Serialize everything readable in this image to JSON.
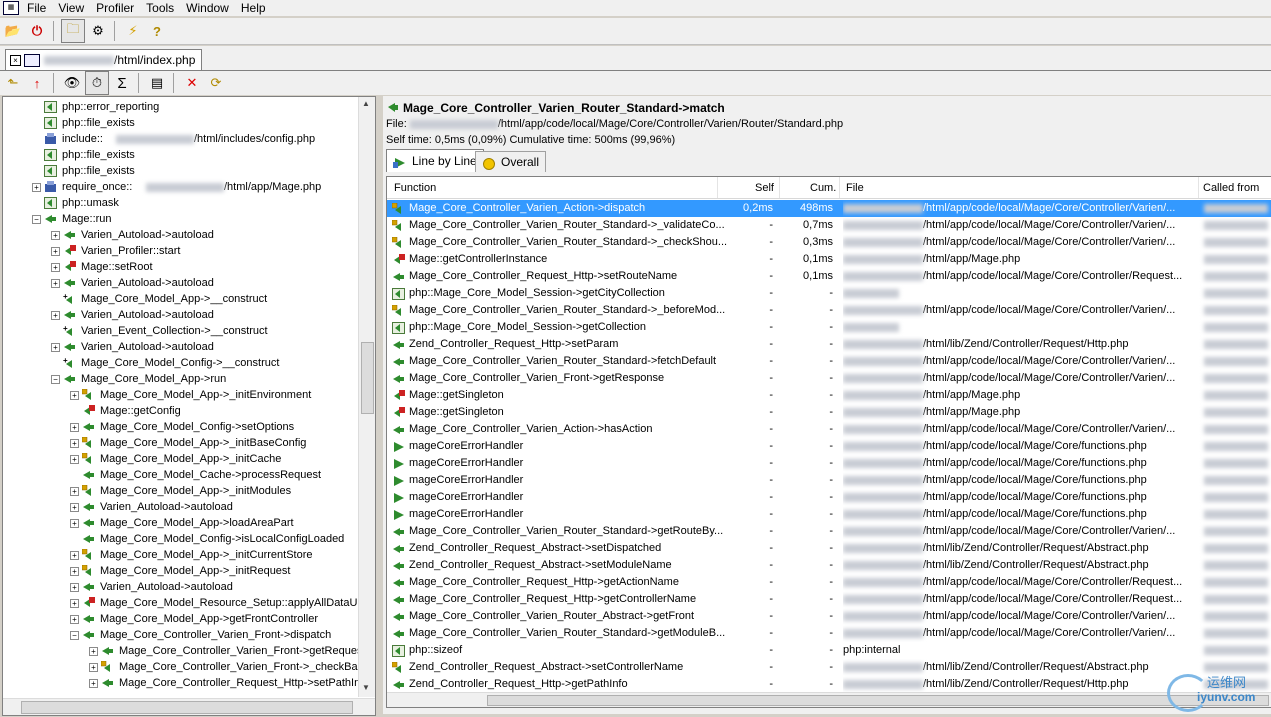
{
  "menu": [
    "File",
    "View",
    "Profiler",
    "Tools",
    "Window",
    "Help"
  ],
  "doc_tab": {
    "path": "/html/index.php"
  },
  "tree": [
    {
      "label": "php::error_reporting",
      "depth": 1,
      "exp": "",
      "icon": "php"
    },
    {
      "label": "php::file_exists",
      "depth": 1,
      "exp": "",
      "icon": "php"
    },
    {
      "label": "include::",
      "suffix": "/html/includes/config.php",
      "depth": 1,
      "exp": "",
      "icon": "include"
    },
    {
      "label": "php::file_exists",
      "depth": 1,
      "exp": "",
      "icon": "php"
    },
    {
      "label": "php::file_exists",
      "depth": 1,
      "exp": "",
      "icon": "php"
    },
    {
      "label": "require_once::",
      "suffix": "/html/app/Mage.php",
      "depth": 1,
      "exp": "+",
      "icon": "include"
    },
    {
      "label": "php::umask",
      "depth": 1,
      "exp": "",
      "icon": "php"
    },
    {
      "label": "Mage::run",
      "depth": 1,
      "exp": "-",
      "icon": "method"
    },
    {
      "label": "Varien_Autoload->autoload",
      "depth": 2,
      "exp": "+",
      "icon": "method"
    },
    {
      "label": "Varien_Profiler::start",
      "depth": 2,
      "exp": "+",
      "icon": "static"
    },
    {
      "label": "Mage::setRoot",
      "depth": 2,
      "exp": "+",
      "icon": "static"
    },
    {
      "label": "Varien_Autoload->autoload",
      "depth": 2,
      "exp": "+",
      "icon": "method"
    },
    {
      "label": "Mage_Core_Model_App->__construct",
      "depth": 2,
      "exp": "",
      "icon": "construct"
    },
    {
      "label": "Varien_Autoload->autoload",
      "depth": 2,
      "exp": "+",
      "icon": "method"
    },
    {
      "label": "Varien_Event_Collection->__construct",
      "depth": 2,
      "exp": "",
      "icon": "construct"
    },
    {
      "label": "Varien_Autoload->autoload",
      "depth": 2,
      "exp": "+",
      "icon": "method"
    },
    {
      "label": "Mage_Core_Model_Config->__construct",
      "depth": 2,
      "exp": "",
      "icon": "construct"
    },
    {
      "label": "Mage_Core_Model_App->run",
      "depth": 2,
      "exp": "-",
      "icon": "method"
    },
    {
      "label": "Mage_Core_Model_App->_initEnvironment",
      "depth": 3,
      "exp": "+",
      "icon": "private"
    },
    {
      "label": "Mage::getConfig",
      "depth": 3,
      "exp": "",
      "icon": "static"
    },
    {
      "label": "Mage_Core_Model_Config->setOptions",
      "depth": 3,
      "exp": "+",
      "icon": "method"
    },
    {
      "label": "Mage_Core_Model_App->_initBaseConfig",
      "depth": 3,
      "exp": "+",
      "icon": "private"
    },
    {
      "label": "Mage_Core_Model_App->_initCache",
      "depth": 3,
      "exp": "+",
      "icon": "private"
    },
    {
      "label": "Mage_Core_Model_Cache->processRequest",
      "depth": 3,
      "exp": "",
      "icon": "method"
    },
    {
      "label": "Mage_Core_Model_App->_initModules",
      "depth": 3,
      "exp": "+",
      "icon": "private"
    },
    {
      "label": "Varien_Autoload->autoload",
      "depth": 3,
      "exp": "+",
      "icon": "method"
    },
    {
      "label": "Mage_Core_Model_App->loadAreaPart",
      "depth": 3,
      "exp": "+",
      "icon": "method"
    },
    {
      "label": "Mage_Core_Model_Config->isLocalConfigLoaded",
      "depth": 3,
      "exp": "",
      "icon": "method"
    },
    {
      "label": "Mage_Core_Model_App->_initCurrentStore",
      "depth": 3,
      "exp": "+",
      "icon": "private"
    },
    {
      "label": "Mage_Core_Model_App->_initRequest",
      "depth": 3,
      "exp": "+",
      "icon": "private"
    },
    {
      "label": "Varien_Autoload->autoload",
      "depth": 3,
      "exp": "+",
      "icon": "method"
    },
    {
      "label": "Mage_Core_Model_Resource_Setup::applyAllDataUpdates",
      "depth": 3,
      "exp": "+",
      "icon": "static"
    },
    {
      "label": "Mage_Core_Model_App->getFrontController",
      "depth": 3,
      "exp": "+",
      "icon": "method"
    },
    {
      "label": "Mage_Core_Controller_Varien_Front->dispatch",
      "depth": 3,
      "exp": "-",
      "icon": "method"
    },
    {
      "label": "Mage_Core_Controller_Varien_Front->getRequest",
      "depth": 4,
      "exp": "+",
      "icon": "method"
    },
    {
      "label": "Mage_Core_Controller_Varien_Front->_checkBaseUrl",
      "depth": 4,
      "exp": "+",
      "icon": "private"
    },
    {
      "label": "Mage_Core_Controller_Request_Http->setPathInfo",
      "depth": 4,
      "exp": "+",
      "icon": "method"
    }
  ],
  "detail": {
    "title": "Mage_Core_Controller_Varien_Router_Standard->match",
    "file_label": "File:",
    "file_path": "/html/app/code/local/Mage/Core/Controller/Varien/Router/Standard.php",
    "times": "Self time: 0,5ms (0,09%)   Cumulative time: 500ms (99,96%)"
  },
  "tabs": [
    {
      "label": "Line by Line",
      "active": true
    },
    {
      "label": "Overall",
      "active": false
    }
  ],
  "columns": [
    "Function",
    "Self",
    "Cum.",
    "File",
    "Called from"
  ],
  "rows": [
    {
      "fn": "Mage_Core_Controller_Varien_Action->dispatch",
      "self": "0,2ms",
      "cum": "498ms",
      "file": "/html/app/code/local/Mage/Core/Controller/Varien/...",
      "blur": true,
      "icon": "private",
      "sel": true
    },
    {
      "fn": "Mage_Core_Controller_Varien_Router_Standard->_validateCo...",
      "self": "-",
      "cum": "0,7ms",
      "file": "/html/app/code/local/Mage/Core/Controller/Varien/...",
      "blur": true,
      "icon": "private"
    },
    {
      "fn": "Mage_Core_Controller_Varien_Router_Standard->_checkShou...",
      "self": "-",
      "cum": "0,3ms",
      "file": "/html/app/code/local/Mage/Core/Controller/Varien/...",
      "blur": true,
      "icon": "private"
    },
    {
      "fn": "Mage::getControllerInstance",
      "self": "-",
      "cum": "0,1ms",
      "file": "/html/app/Mage.php",
      "blur": true,
      "icon": "static"
    },
    {
      "fn": "Mage_Core_Controller_Request_Http->setRouteName",
      "self": "-",
      "cum": "0,1ms",
      "file": "/html/app/code/local/Mage/Core/Controller/Request...",
      "blur": true,
      "icon": "method"
    },
    {
      "fn": "php::Mage_Core_Model_Session->getCityCollection",
      "self": "-",
      "cum": "-",
      "file": "",
      "blur": true,
      "icon": "php"
    },
    {
      "fn": "Mage_Core_Controller_Varien_Router_Standard->_beforeMod...",
      "self": "-",
      "cum": "-",
      "file": "/html/app/code/local/Mage/Core/Controller/Varien/...",
      "blur": true,
      "icon": "private"
    },
    {
      "fn": "php::Mage_Core_Model_Session->getCollection",
      "self": "-",
      "cum": "-",
      "file": "",
      "blur": true,
      "icon": "php"
    },
    {
      "fn": "Zend_Controller_Request_Http->setParam",
      "self": "-",
      "cum": "-",
      "file": "/html/lib/Zend/Controller/Request/Http.php",
      "blur": true,
      "icon": "method"
    },
    {
      "fn": "Mage_Core_Controller_Varien_Router_Standard->fetchDefault",
      "self": "-",
      "cum": "-",
      "file": "/html/app/code/local/Mage/Core/Controller/Varien/...",
      "blur": true,
      "icon": "method"
    },
    {
      "fn": "Mage_Core_Controller_Varien_Front->getResponse",
      "self": "-",
      "cum": "-",
      "file": "/html/app/code/local/Mage/Core/Controller/Varien/...",
      "blur": true,
      "icon": "method"
    },
    {
      "fn": "Mage::getSingleton",
      "self": "-",
      "cum": "-",
      "file": "/html/app/Mage.php",
      "blur": true,
      "icon": "static"
    },
    {
      "fn": "Mage::getSingleton",
      "self": "-",
      "cum": "-",
      "file": "/html/app/Mage.php",
      "blur": true,
      "icon": "static"
    },
    {
      "fn": "Mage_Core_Controller_Varien_Action->hasAction",
      "self": "-",
      "cum": "-",
      "file": "/html/app/code/local/Mage/Core/Controller/Varien/...",
      "blur": true,
      "icon": "method"
    },
    {
      "fn": "mageCoreErrorHandler",
      "self": "-",
      "cum": "-",
      "file": "/html/app/code/local/Mage/Core/functions.php",
      "blur": true,
      "icon": "func"
    },
    {
      "fn": "mageCoreErrorHandler",
      "self": "-",
      "cum": "-",
      "file": "/html/app/code/local/Mage/Core/functions.php",
      "blur": true,
      "icon": "func"
    },
    {
      "fn": "mageCoreErrorHandler",
      "self": "-",
      "cum": "-",
      "file": "/html/app/code/local/Mage/Core/functions.php",
      "blur": true,
      "icon": "func"
    },
    {
      "fn": "mageCoreErrorHandler",
      "self": "-",
      "cum": "-",
      "file": "/html/app/code/local/Mage/Core/functions.php",
      "blur": true,
      "icon": "func"
    },
    {
      "fn": "mageCoreErrorHandler",
      "self": "-",
      "cum": "-",
      "file": "/html/app/code/local/Mage/Core/functions.php",
      "blur": true,
      "icon": "func"
    },
    {
      "fn": "Mage_Core_Controller_Varien_Router_Standard->getRouteBy...",
      "self": "-",
      "cum": "-",
      "file": "/html/app/code/local/Mage/Core/Controller/Varien/...",
      "blur": true,
      "icon": "method"
    },
    {
      "fn": "Zend_Controller_Request_Abstract->setDispatched",
      "self": "-",
      "cum": "-",
      "file": "/html/lib/Zend/Controller/Request/Abstract.php",
      "blur": true,
      "icon": "method"
    },
    {
      "fn": "Zend_Controller_Request_Abstract->setModuleName",
      "self": "-",
      "cum": "-",
      "file": "/html/lib/Zend/Controller/Request/Abstract.php",
      "blur": true,
      "icon": "method"
    },
    {
      "fn": "Mage_Core_Controller_Request_Http->getActionName",
      "self": "-",
      "cum": "-",
      "file": "/html/app/code/local/Mage/Core/Controller/Request...",
      "blur": true,
      "icon": "method"
    },
    {
      "fn": "Mage_Core_Controller_Request_Http->getControllerName",
      "self": "-",
      "cum": "-",
      "file": "/html/app/code/local/Mage/Core/Controller/Request...",
      "blur": true,
      "icon": "method"
    },
    {
      "fn": "Mage_Core_Controller_Varien_Router_Abstract->getFront",
      "self": "-",
      "cum": "-",
      "file": "/html/app/code/local/Mage/Core/Controller/Varien/...",
      "blur": true,
      "icon": "method"
    },
    {
      "fn": "Mage_Core_Controller_Varien_Router_Standard->getModuleB...",
      "self": "-",
      "cum": "-",
      "file": "/html/app/code/local/Mage/Core/Controller/Varien/...",
      "blur": true,
      "icon": "method"
    },
    {
      "fn": "php::sizeof",
      "self": "-",
      "cum": "-",
      "file": "php:internal",
      "blur": false,
      "icon": "php"
    },
    {
      "fn": "Zend_Controller_Request_Abstract->setControllerName",
      "self": "-",
      "cum": "-",
      "file": "/html/lib/Zend/Controller/Request/Abstract.php",
      "blur": true,
      "icon": "private"
    },
    {
      "fn": "Zend_Controller_Request_Http->getPathInfo",
      "self": "-",
      "cum": "-",
      "file": "/html/lib/Zend/Controller/Request/Http.php",
      "blur": true,
      "icon": "method"
    }
  ],
  "watermark": {
    "cn": "运维网",
    "en": "iyunv.com"
  },
  "colors": {
    "selection": "#3399ff",
    "method_icon": "#2e8b2e",
    "static_icon": "#cc2222"
  }
}
